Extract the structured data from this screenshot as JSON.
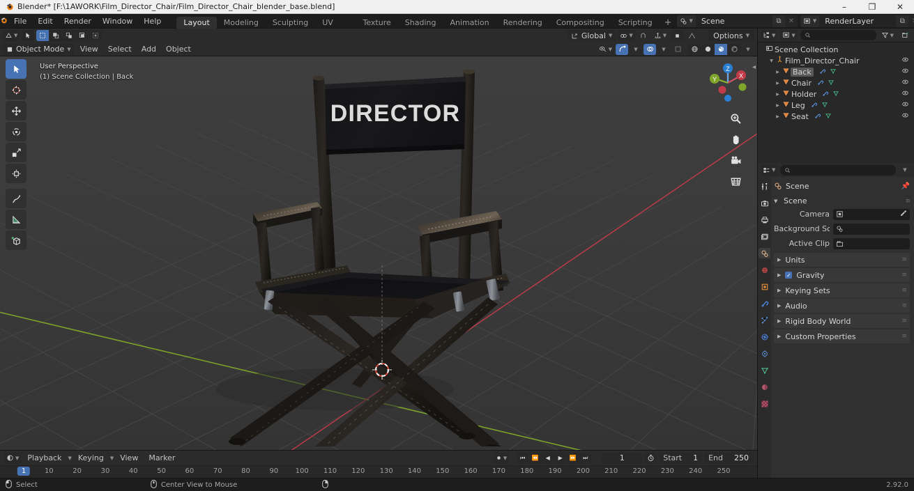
{
  "titlebar": {
    "app_icon": "blender-logo",
    "title": "Blender* [F:\\1AWORK\\Film_Director_Chair/Film_Director_Chair_blender_base.blend]",
    "minimize": "–",
    "maximize": "❐",
    "close": "✕"
  },
  "topbar": {
    "menus": [
      "File",
      "Edit",
      "Render",
      "Window",
      "Help"
    ],
    "workspaces": [
      {
        "label": "Layout",
        "active": true
      },
      {
        "label": "Modeling",
        "active": false
      },
      {
        "label": "Sculpting",
        "active": false
      },
      {
        "label": "UV Editing",
        "active": false
      },
      {
        "label": "Texture Paint",
        "active": false
      },
      {
        "label": "Shading",
        "active": false
      },
      {
        "label": "Animation",
        "active": false
      },
      {
        "label": "Rendering",
        "active": false
      },
      {
        "label": "Compositing",
        "active": false
      },
      {
        "label": "Scripting",
        "active": false
      }
    ],
    "add_workspace": "+",
    "scene_name": "Scene",
    "viewlayer_name": "RenderLayer"
  },
  "viewport": {
    "header": {
      "editor_type": "editor-type-3dview",
      "select_modes": [
        "tweak",
        "box",
        "circle",
        "lasso"
      ],
      "mode": "Object Mode",
      "menus": [
        "View",
        "Select",
        "Add",
        "Object"
      ],
      "orientation": "Global",
      "options_label": "Options",
      "snap_icon": "magnet-icon",
      "proportional_icon": "proportional-editing-icon"
    },
    "overlay_line1": "User Perspective",
    "overlay_line2": "(1) Scene Collection | Back",
    "gizmo_axes": {
      "z": "Z",
      "x": "X",
      "y": "Y"
    },
    "nav_buttons": [
      "zoom-icon",
      "hand-icon",
      "camera-icon",
      "grid-icon"
    ],
    "tools": [
      {
        "name": "tweak-select-tool",
        "active": true
      },
      {
        "name": "cursor-tool",
        "active": false
      },
      {
        "name": "move-tool",
        "active": false
      },
      {
        "name": "rotate-tool",
        "active": false
      },
      {
        "name": "scale-tool",
        "active": false
      },
      {
        "name": "transform-tool",
        "active": false
      },
      {
        "name": "annotate-tool",
        "active": false
      },
      {
        "name": "measure-tool",
        "active": false
      },
      {
        "name": "add-cube-tool",
        "active": false
      }
    ],
    "shading_modes": [
      "wireframe",
      "solid",
      "material-preview",
      "rendered"
    ],
    "active_shading": "material-preview",
    "model_text": "DIRECTOR"
  },
  "timeline": {
    "menus": [
      "Playback",
      "Keying",
      "View",
      "Marker"
    ],
    "current_frame": "1",
    "start_label": "Start",
    "start_value": "1",
    "end_label": "End",
    "end_value": "250",
    "ticks": [
      "1",
      "10",
      "20",
      "30",
      "40",
      "50",
      "60",
      "70",
      "80",
      "90",
      "100",
      "110",
      "120",
      "130",
      "140",
      "150",
      "160",
      "170",
      "180",
      "190",
      "200",
      "210",
      "220",
      "230",
      "240",
      "250"
    ],
    "playhead_label": "1"
  },
  "outliner": {
    "search_placeholder": "",
    "scene_collection": "Scene Collection",
    "items": [
      {
        "label": "Film_Director_Chair",
        "icon": "collection-icon",
        "indent": 1,
        "expanded": true,
        "active": false,
        "has_data": false
      },
      {
        "label": "Back",
        "icon": "mesh-object-icon",
        "indent": 2,
        "expanded": false,
        "active": true,
        "has_data": true
      },
      {
        "label": "Chair",
        "icon": "mesh-object-icon",
        "indent": 2,
        "expanded": false,
        "active": false,
        "has_data": true
      },
      {
        "label": "Holder",
        "icon": "mesh-object-icon",
        "indent": 2,
        "expanded": false,
        "active": false,
        "has_data": true
      },
      {
        "label": "Leg",
        "icon": "mesh-object-icon",
        "indent": 2,
        "expanded": false,
        "active": false,
        "has_data": true
      },
      {
        "label": "Seat",
        "icon": "mesh-object-icon",
        "indent": 2,
        "expanded": false,
        "active": false,
        "has_data": true
      }
    ]
  },
  "properties": {
    "breadcrumb": "Scene",
    "tabs": [
      "tool",
      "render",
      "output",
      "view-layer",
      "scene",
      "world",
      "object",
      "modifier",
      "particles",
      "physics",
      "constraints",
      "data",
      "material",
      "texture"
    ],
    "active_tab": "scene",
    "scene_panel_title": "Scene",
    "rows": [
      {
        "label": "Camera",
        "icon": "camera-icon",
        "value": "",
        "eyedropper": true
      },
      {
        "label": "Background Sce...",
        "icon": "scene-icon",
        "value": "",
        "eyedropper": false
      },
      {
        "label": "Active Clip",
        "icon": "clip-icon",
        "value": "",
        "eyedropper": false
      }
    ],
    "panels": [
      {
        "label": "Units",
        "checkbox": false
      },
      {
        "label": "Gravity",
        "checkbox": true
      },
      {
        "label": "Keying Sets",
        "checkbox": false
      },
      {
        "label": "Audio",
        "checkbox": false
      },
      {
        "label": "Rigid Body World",
        "checkbox": false
      },
      {
        "label": "Custom Properties",
        "checkbox": false
      }
    ]
  },
  "statusbar": {
    "item1": "Select",
    "item2": "Center View to Mouse",
    "version": "2.92.0"
  },
  "colors": {
    "accent_blue": "#4772b3",
    "orange": "#e87d0d",
    "axis_x": "#c13b4a",
    "axis_y": "#7fa62a",
    "axis_z": "#2b7fd4",
    "bg_dark": "#1d1d1d",
    "viewport_bg": "#3b3b3b"
  }
}
